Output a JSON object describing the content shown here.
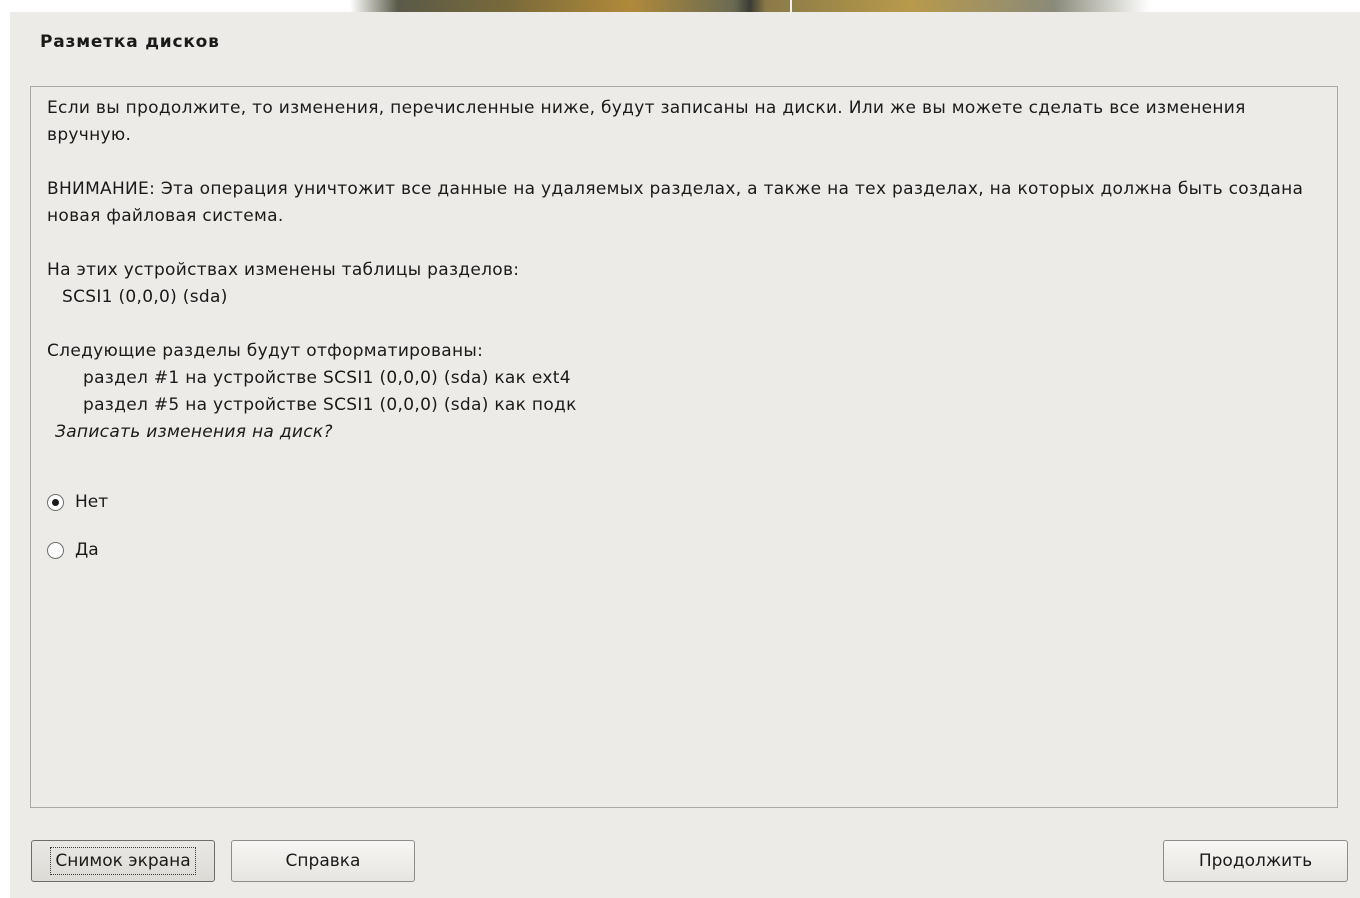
{
  "dialog": {
    "title": "Разметка дисков",
    "intro": "Если вы продолжите, то изменения, перечисленные ниже, будут записаны на диски. Или же вы можете сделать все изменения вручную.",
    "warning": "ВНИМАНИЕ: Эта операция уничтожит все данные на удаляемых разделах, а также на тех разделах, на которых должна быть создана новая файловая система.",
    "partition_tables_heading": "На этих устройствах изменены таблицы разделов:",
    "partition_tables_devices": [
      "SCSI1 (0,0,0) (sda)"
    ],
    "format_heading": "Следующие разделы будут отформатированы:",
    "format_items": [
      "раздел #1 на устройстве SCSI1 (0,0,0) (sda) как ext4",
      "раздел #5 на устройстве SCSI1 (0,0,0) (sda) как подк"
    ],
    "question": "Записать изменения на диск?",
    "options": [
      {
        "label": "Нет",
        "selected": true
      },
      {
        "label": "Да",
        "selected": false
      }
    ]
  },
  "buttons": {
    "screenshot": "Снимок экрана",
    "help": "Справка",
    "continue": "Продолжить"
  }
}
